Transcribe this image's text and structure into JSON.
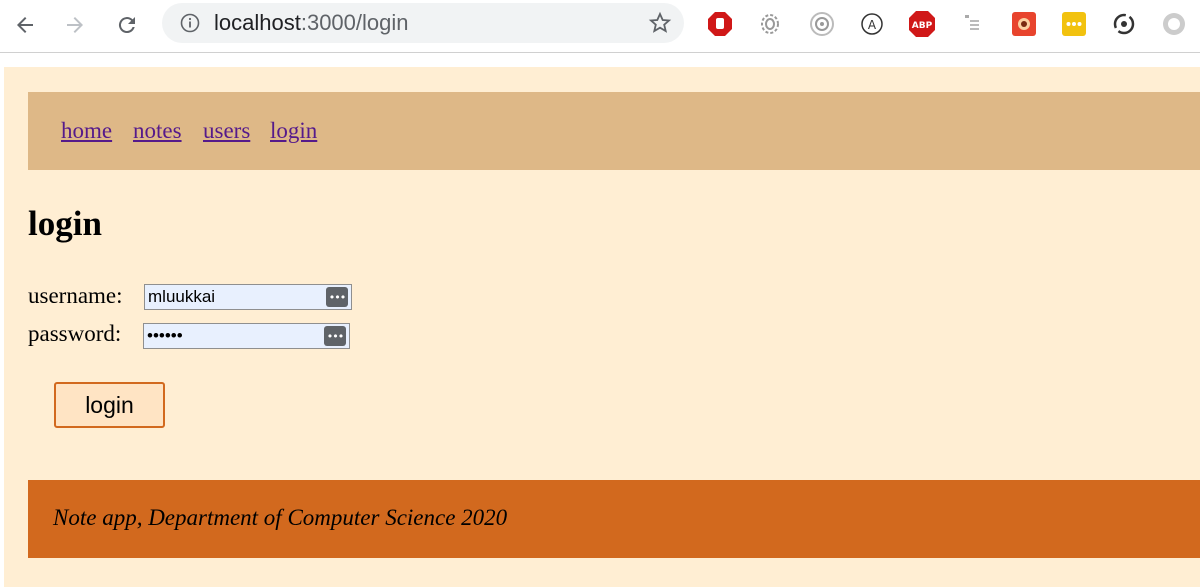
{
  "browser": {
    "url_host": "localhost",
    "url_rest": ":3000/login",
    "extensions": [
      "hand-stop-icon",
      "fingerprint-icon",
      "target-icon",
      "a-circle-icon",
      "abp-icon",
      "tag-icon",
      "puzzle-icon",
      "dots-icon",
      "refresh-icon",
      "circle-icon"
    ]
  },
  "nav": {
    "links": [
      "home",
      "notes",
      "users",
      "login"
    ]
  },
  "page": {
    "heading": "login"
  },
  "form": {
    "username_label": "username:",
    "username_value": "mluukkai",
    "password_label": "password:",
    "password_value": "••••••",
    "submit_label": "login"
  },
  "footer": {
    "text": "Note app, Department of Computer Science 2020"
  },
  "colors": {
    "page_bg": "#ffeed3",
    "navbar_bg": "#deb887",
    "footer_bg": "#d2691e",
    "link": "#551a8b"
  }
}
